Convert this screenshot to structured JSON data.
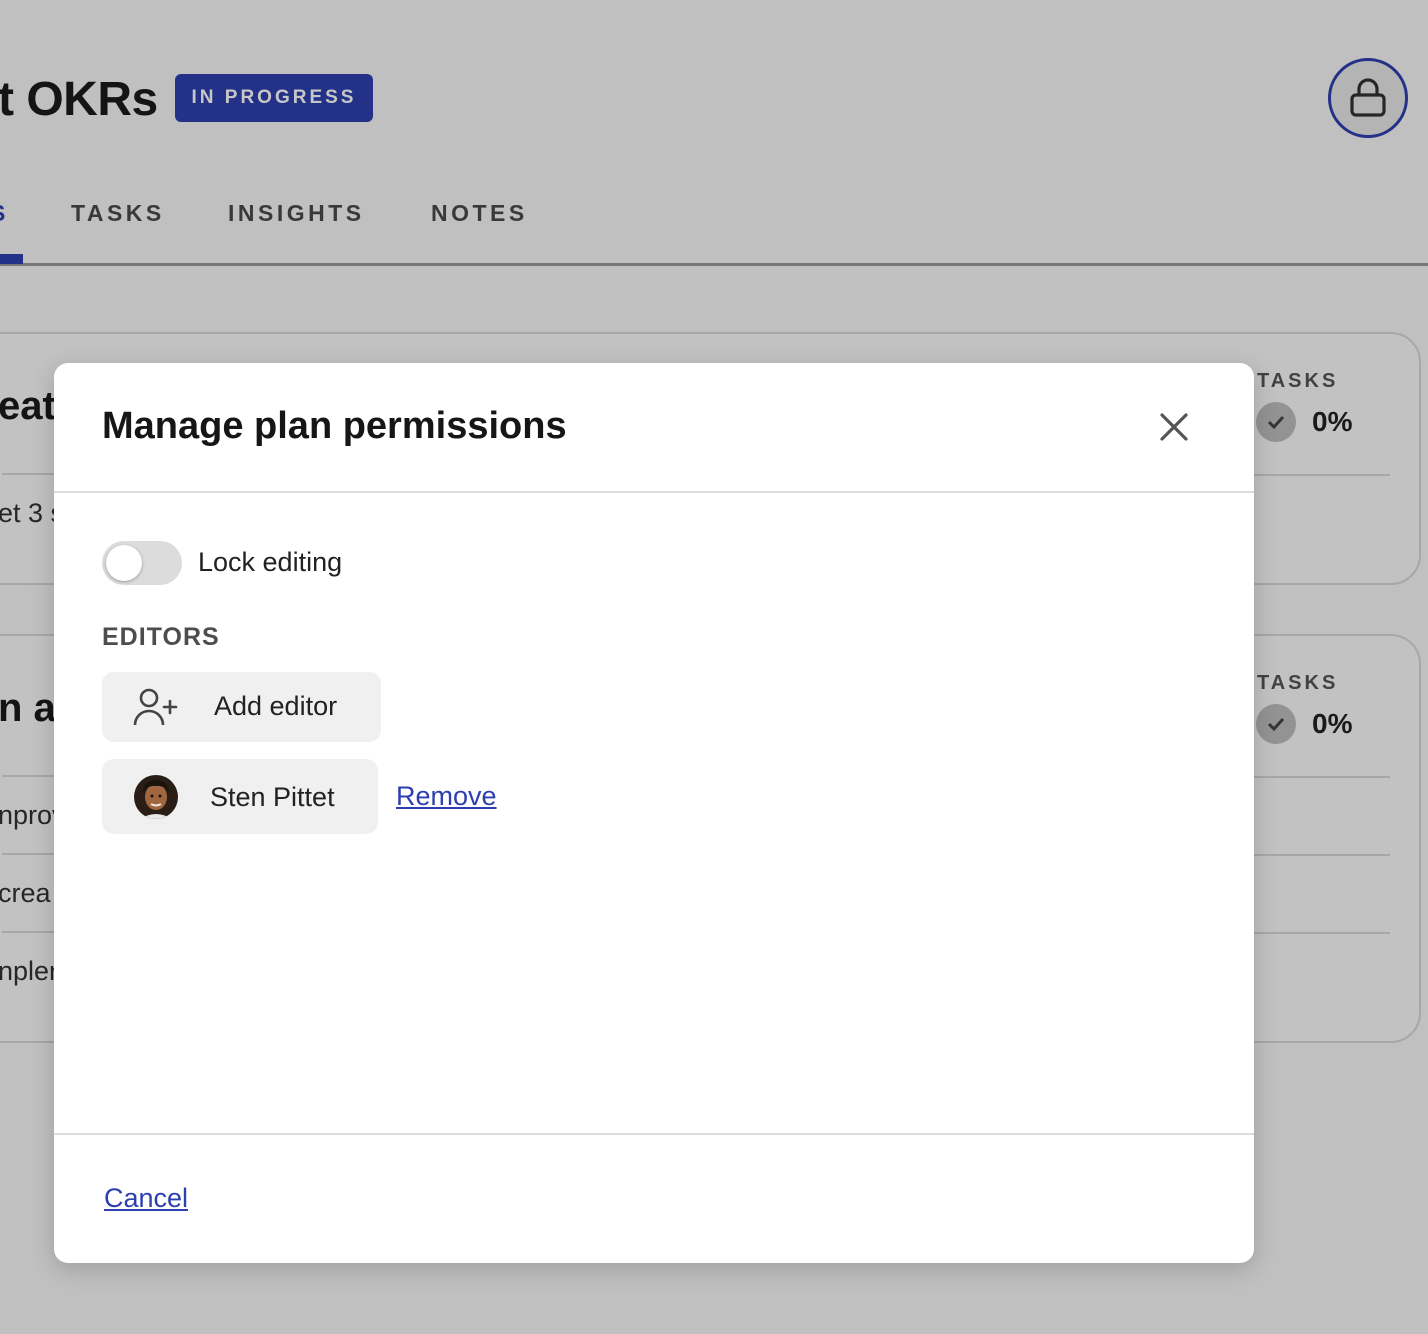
{
  "header": {
    "title": "t OKRs",
    "status_badge": "IN PROGRESS"
  },
  "tabs": [
    {
      "label": "S",
      "active": true
    },
    {
      "label": "TASKS",
      "active": false
    },
    {
      "label": "INSIGHTS",
      "active": false
    },
    {
      "label": "NOTES",
      "active": false
    }
  ],
  "cards": [
    {
      "heading": "eat",
      "lines": [
        "et 3 s"
      ],
      "tasks_label": "TASKS",
      "tasks_percent": "0%"
    },
    {
      "heading": "n ar",
      "lines": [
        "nprov",
        "crea",
        "nplen"
      ],
      "tasks_label": "TASKS",
      "tasks_percent": "0%"
    }
  ],
  "modal": {
    "title": "Manage plan permissions",
    "lock_editing_label": "Lock editing",
    "lock_editing_on": false,
    "editors_section_label": "EDITORS",
    "add_editor_label": "Add editor",
    "editors": [
      {
        "name": "Sten Pittet",
        "remove_label": "Remove"
      }
    ],
    "cancel_label": "Cancel"
  },
  "colors": {
    "accent": "#2d3fb0",
    "overlay": "rgba(0,0,0,0.22)"
  },
  "icons": {
    "lock": "lock-icon",
    "close": "close-icon",
    "add_user": "add-user-icon",
    "check": "check-icon"
  }
}
